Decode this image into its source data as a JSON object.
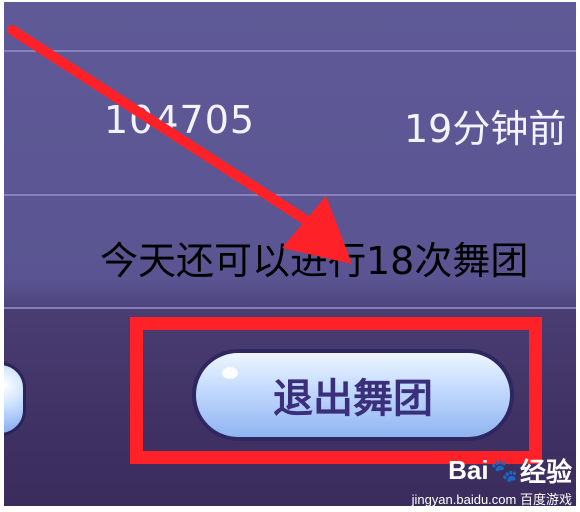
{
  "dance_group": {
    "member_id": "104705",
    "last_active": "19分钟前",
    "notice": "今天还可以进行18次舞团",
    "exit_button_label": "退出舞团"
  },
  "annotation": {
    "highlight_color": "#ff2128",
    "arrow_color": "#ff2128"
  },
  "watermark": {
    "brand": "Bai",
    "brand_suffix": "经验",
    "url": "jingyan.baidu.com",
    "sub": "百度游戏"
  },
  "colors": {
    "panel_top": "#5f5a97",
    "panel_bottom": "#3a2c5c",
    "button_text": "#3a2f7a"
  }
}
